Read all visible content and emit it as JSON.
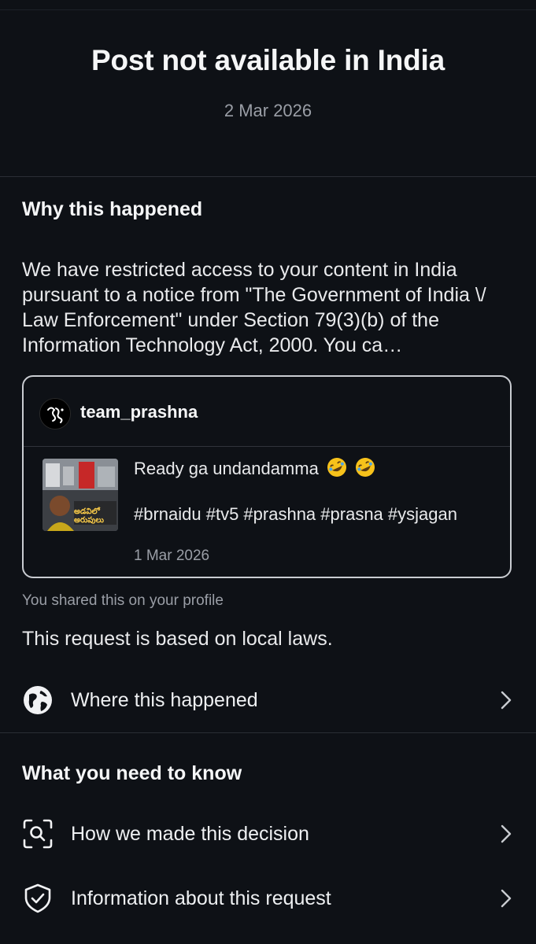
{
  "header": {
    "title": "Post not available in India",
    "date": "2 Mar 2026"
  },
  "why": {
    "heading": "Why this happened",
    "body": "We have restricted access to your content in India pursuant to a notice from \"The Government of India \\/ Law Enforcement\" under Section 79(3)(b) of the Information Technology Act, 2000. You ca…"
  },
  "post_card": {
    "username": "team_prashna",
    "text": "Ready ga undandamma",
    "emoji": [
      "rolling-on-floor-laughing",
      "rolling-on-floor-laughing"
    ],
    "tags": "#brnaidu #tv5 #prashna #prasna #ysjagan",
    "date": "1 Mar 2026",
    "thumbnail_caption": "అడవిలో అరుపులు"
  },
  "shared_note": "You shared this on your profile",
  "laws_text": "This request is based on local laws.",
  "where_row": {
    "label": "Where this happened",
    "icon": "globe-icon"
  },
  "know": {
    "heading": "What you need to know",
    "items": [
      {
        "label": "How we made this decision",
        "icon": "scan-search-icon"
      },
      {
        "label": "Information about this request",
        "icon": "shield-check-icon"
      }
    ]
  },
  "colors": {
    "background": "#0e1116",
    "text": "#f1f2f4",
    "muted": "#9a9ea6",
    "divider": "#2a2e35",
    "card_border": "#c9ccd1"
  }
}
